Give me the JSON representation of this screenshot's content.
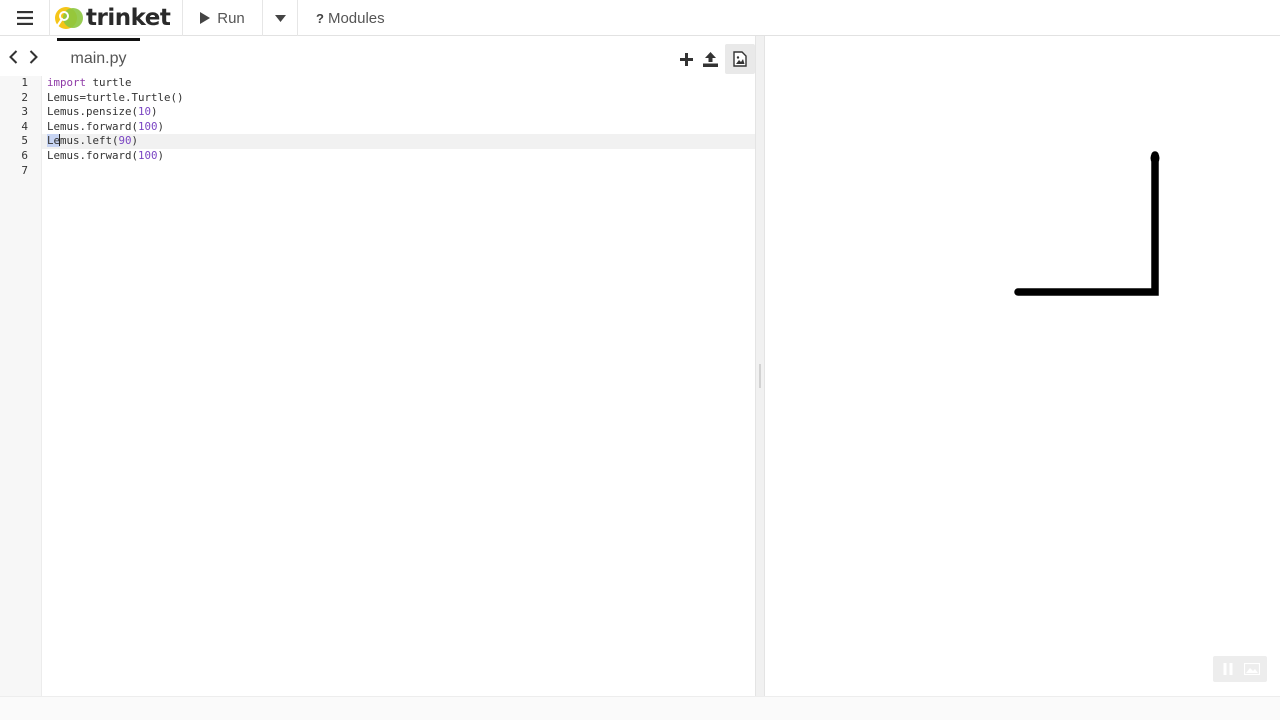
{
  "header": {
    "logo_text": "trinket",
    "run_label": "Run",
    "modules_label": "Modules",
    "modules_icon_glyph": "?"
  },
  "editor": {
    "tab_label": "main.py",
    "cursor_line": 5,
    "lines": [
      {
        "no": "1",
        "segments": [
          {
            "t": "import",
            "c": "kw"
          },
          {
            "t": " turtle",
            "c": ""
          }
        ]
      },
      {
        "no": "2",
        "segments": [
          {
            "t": "Lemus=turtle.Turtle()",
            "c": ""
          }
        ]
      },
      {
        "no": "3",
        "segments": [
          {
            "t": "Lemus.pensize(",
            "c": ""
          },
          {
            "t": "10",
            "c": "num"
          },
          {
            "t": ")",
            "c": ""
          }
        ]
      },
      {
        "no": "4",
        "segments": [
          {
            "t": "Lemus.forward(",
            "c": ""
          },
          {
            "t": "100",
            "c": "num"
          },
          {
            "t": ")",
            "c": ""
          }
        ]
      },
      {
        "no": "5",
        "segments": [
          {
            "t": "Le",
            "c": "sel"
          },
          {
            "t": "mus.left(",
            "c": ""
          },
          {
            "t": "90",
            "c": "num"
          },
          {
            "t": ")",
            "c": ""
          }
        ]
      },
      {
        "no": "6",
        "segments": [
          {
            "t": "Lemus.forward(",
            "c": ""
          },
          {
            "t": "100",
            "c": "num"
          },
          {
            "t": ")",
            "c": ""
          }
        ]
      },
      {
        "no": "7",
        "segments": []
      }
    ]
  },
  "colors": {
    "accent_logo_yellow": "#f5c518",
    "accent_logo_green": "#8cc63f",
    "keyword": "#8e3aa7",
    "number": "#7a45c3",
    "selection": "#c7d4f3",
    "turtle_stroke": "#000000"
  },
  "icons": {
    "menu": "hamburger-icon",
    "run": "play-icon",
    "dropdown": "caret-down-icon",
    "back": "chevron-left-icon",
    "forward": "chevron-right-icon",
    "add_file": "plus-icon",
    "upload": "upload-icon",
    "image_library": "image-icon",
    "pause": "pause-icon",
    "snapshot": "image-icon"
  },
  "output": {
    "turtle": {
      "pensize": 10,
      "moves": [
        {
          "cmd": "forward",
          "value": 100
        },
        {
          "cmd": "left",
          "value": 90
        },
        {
          "cmd": "forward",
          "value": 100
        }
      ]
    }
  }
}
